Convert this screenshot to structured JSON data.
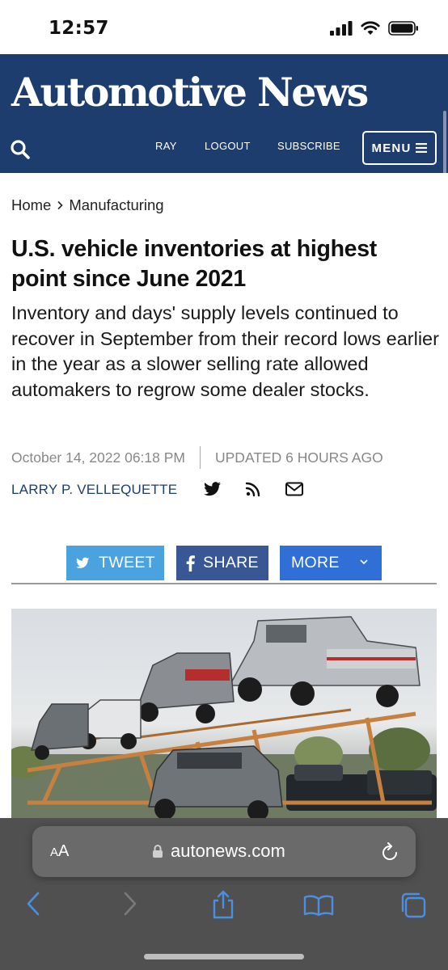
{
  "status_bar": {
    "time": "12:57"
  },
  "header": {
    "logo": "Automotive News",
    "nav": {
      "ray": "RAY",
      "logout": "LOGOUT",
      "subscribe": "SUBSCRIBE",
      "menu": "MENU"
    }
  },
  "breadcrumb": {
    "home": "Home",
    "section": "Manufacturing"
  },
  "article": {
    "headline": "U.S. vehicle inventories at highest point since June 2021",
    "subhead": "Inventory and days' supply levels continued to recover in September from their record lows earlier in the year as a slower selling rate allowed automakers to regrow some dealer stocks.",
    "date": "October 14, 2022 06:18 PM",
    "updated": "UPDATED 6 HOURS AGO",
    "author": "LARRY P. VELLEQUETTE"
  },
  "share": {
    "tweet": "TWEET",
    "share": "SHARE",
    "more": "MORE"
  },
  "browser": {
    "aa_small": "A",
    "aa_large": "A",
    "url": "autonews.com"
  },
  "colors": {
    "brand_navy": "#1c3d6e",
    "twitter": "#4aa3df",
    "facebook": "#3a5795",
    "more": "#2f6fd6",
    "safari_tint": "#4a8fe0"
  }
}
